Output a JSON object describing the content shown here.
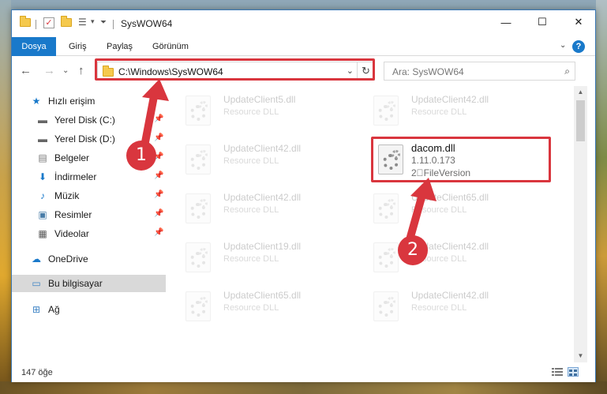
{
  "window": {
    "title": "SysWOW64"
  },
  "ribbon": {
    "tabs": [
      "Dosya",
      "Giriş",
      "Paylaş",
      "Görünüm"
    ],
    "help": "?"
  },
  "address": {
    "path": "C:\\Windows\\SysWOW64",
    "search_placeholder": "Ara: SysWOW64"
  },
  "sidebar": {
    "items": [
      {
        "label": "Hızlı erişim",
        "icon": "star-icon"
      },
      {
        "label": "Yerel Disk (C:)",
        "icon": "drive-icon"
      },
      {
        "label": "Yerel Disk (D:)",
        "icon": "drive-icon"
      },
      {
        "label": "Belgeler",
        "icon": "document-icon"
      },
      {
        "label": "İndirmeler",
        "icon": "download-icon"
      },
      {
        "label": "Müzik",
        "icon": "music-icon"
      },
      {
        "label": "Resimler",
        "icon": "pictures-icon"
      },
      {
        "label": "Videolar",
        "icon": "video-icon"
      },
      {
        "label": "OneDrive",
        "icon": "cloud-icon"
      },
      {
        "label": "Bu bilgisayar",
        "icon": "computer-icon"
      },
      {
        "label": "Ağ",
        "icon": "network-icon"
      }
    ]
  },
  "files": [
    {
      "name": "UpdateClient5.dll",
      "sub": "Resource DLL"
    },
    {
      "name": "UpdateClient42.dll",
      "sub": "Resource DLL"
    },
    {
      "name": "UpdateClient42.dll",
      "sub": "Resource DLL"
    },
    {
      "name": "UpdateClient42.dll",
      "sub": "Resource DLL"
    },
    {
      "name": "UpdateClient65.dll",
      "sub": "Resource DLL"
    },
    {
      "name": "UpdateClient19.dll",
      "sub": "Resource DLL"
    },
    {
      "name": "UpdateClient42.dll",
      "sub": "Resource DLL"
    },
    {
      "name": "UpdateClient65.dll",
      "sub": "Resource DLL"
    },
    {
      "name": "UpdateClient42.dll",
      "sub": "Resource DLL"
    }
  ],
  "highlighted_file": {
    "name": "dacom.dll",
    "version": "1.11.0.173",
    "description": "2\u0000FileVersion"
  },
  "status": {
    "item_count": "147 öğe"
  },
  "annotations": {
    "badge1": "1",
    "badge2": "2"
  },
  "colors": {
    "accent": "#1979ca",
    "annotation_red": "#d9363e"
  }
}
